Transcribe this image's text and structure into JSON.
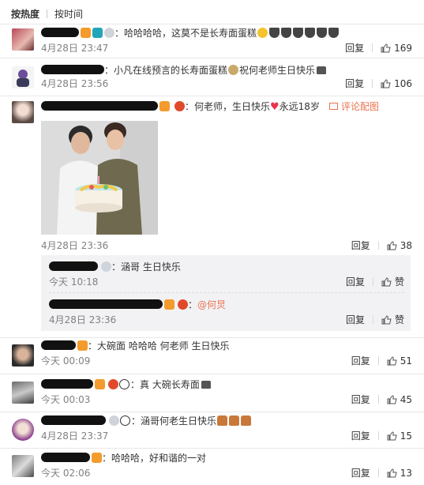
{
  "sort": {
    "hot": "按热度",
    "time": "按时间"
  },
  "actions": {
    "reply": "回复",
    "like": "赞"
  },
  "comments": [
    {
      "text": "：哈哈哈哈，这莫不是长寿面蛋糕",
      "time": "4月28日 23:47",
      "likes": "169"
    },
    {
      "text_prefix": "：小凡在线预言的长寿面蛋糕",
      "text_suffix": "祝何老师生日快乐",
      "time": "4月28日 23:56",
      "likes": "106"
    },
    {
      "text": "：何老师，生日快乐",
      "text_after_heart": "永远18岁",
      "comment_pic": "评论配图",
      "time": "4月28日 23:36",
      "likes": "38",
      "replies": [
        {
          "text": "：涵哥 生日快乐",
          "time": "今天 10:18"
        },
        {
          "text": "：",
          "mention": "@何炅",
          "time": "4月28日 23:36"
        }
      ]
    },
    {
      "text": "：大碗面  哈哈哈 何老师 生日快乐",
      "time": "今天 00:09",
      "likes": "51"
    },
    {
      "text": "：真 大碗长寿面",
      "time": "今天 00:03",
      "likes": "45"
    },
    {
      "text": "：涵哥何老生日快乐",
      "time": "4月28日 23:37",
      "likes": "15"
    },
    {
      "text": "：哈哈哈，好和谐的一对",
      "time": "今天 02:06",
      "likes": "13"
    }
  ]
}
